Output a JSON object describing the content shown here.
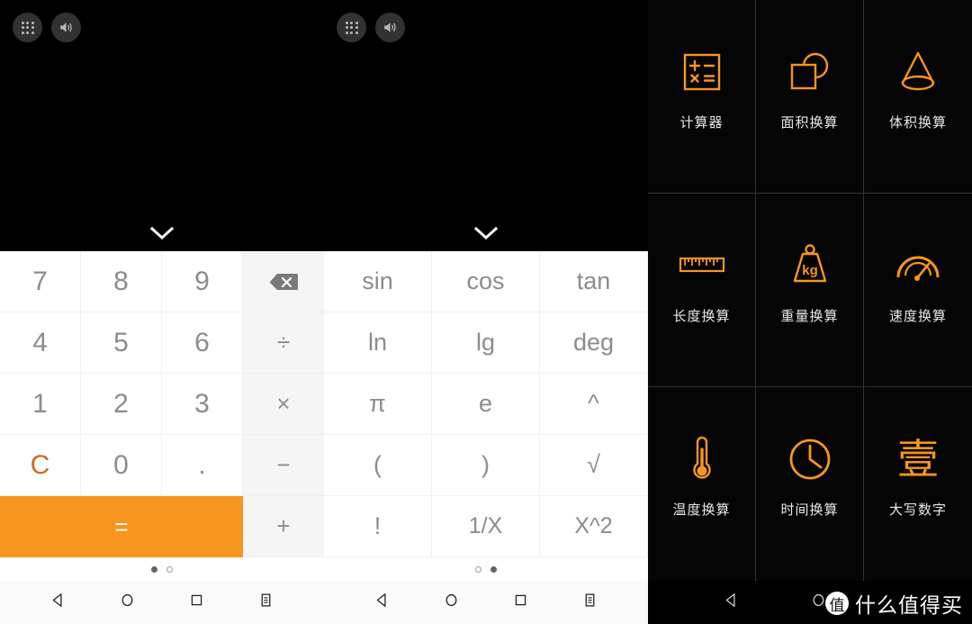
{
  "statusbar": {
    "apps_icon": "grid-icon",
    "volume_icon": "volume-icon"
  },
  "calculator": {
    "collapse_icon": "chevron-down-icon",
    "page_one": {
      "keys": [
        {
          "label": "7",
          "type": "digit"
        },
        {
          "label": "8",
          "type": "digit"
        },
        {
          "label": "9",
          "type": "digit"
        },
        {
          "label": "",
          "type": "backspace"
        },
        {
          "label": "4",
          "type": "digit"
        },
        {
          "label": "5",
          "type": "digit"
        },
        {
          "label": "6",
          "type": "digit"
        },
        {
          "label": "÷",
          "type": "operator"
        },
        {
          "label": "1",
          "type": "digit"
        },
        {
          "label": "2",
          "type": "digit"
        },
        {
          "label": "3",
          "type": "digit"
        },
        {
          "label": "×",
          "type": "operator"
        },
        {
          "label": "C",
          "type": "clear"
        },
        {
          "label": "0",
          "type": "digit"
        },
        {
          "label": ".",
          "type": "digit"
        },
        {
          "label": "−",
          "type": "operator"
        },
        {
          "label": "=",
          "type": "equals"
        },
        {
          "label": "+",
          "type": "operator"
        }
      ],
      "dots": [
        true,
        false
      ]
    },
    "page_two": {
      "keys": [
        {
          "label": "sin"
        },
        {
          "label": "cos"
        },
        {
          "label": "tan"
        },
        {
          "label": "ln"
        },
        {
          "label": "lg"
        },
        {
          "label": "deg"
        },
        {
          "label": "π"
        },
        {
          "label": "e"
        },
        {
          "label": "^"
        },
        {
          "label": "("
        },
        {
          "label": ")"
        },
        {
          "label": "√"
        },
        {
          "label": "!"
        },
        {
          "label": "1/X"
        },
        {
          "label": "X^2"
        }
      ],
      "dots": [
        false,
        true
      ]
    }
  },
  "navbar": {
    "items": [
      {
        "icon": "back-icon"
      },
      {
        "icon": "home-icon"
      },
      {
        "icon": "recents-icon"
      },
      {
        "icon": "menu-icon"
      }
    ],
    "right_items": [
      {
        "icon": "back-icon"
      },
      {
        "icon": "home-icon"
      }
    ]
  },
  "tools": {
    "accent_color": "#f7951e",
    "items": [
      {
        "label": "计算器",
        "icon": "calculator-icon"
      },
      {
        "label": "面积换算",
        "icon": "area-square-circle-icon"
      },
      {
        "label": "体积换算",
        "icon": "cone-volume-icon"
      },
      {
        "label": "长度换算",
        "icon": "ruler-icon"
      },
      {
        "label": "重量换算",
        "icon": "weight-kg-icon"
      },
      {
        "label": "速度换算",
        "icon": "speedometer-icon"
      },
      {
        "label": "温度换算",
        "icon": "thermometer-icon"
      },
      {
        "label": "时间换算",
        "icon": "clock-icon"
      },
      {
        "label": "大写数字",
        "icon": "chinese-numeral-icon",
        "glyph": "壹"
      }
    ]
  },
  "watermark": {
    "logo": "值",
    "text": "什么值得买"
  }
}
